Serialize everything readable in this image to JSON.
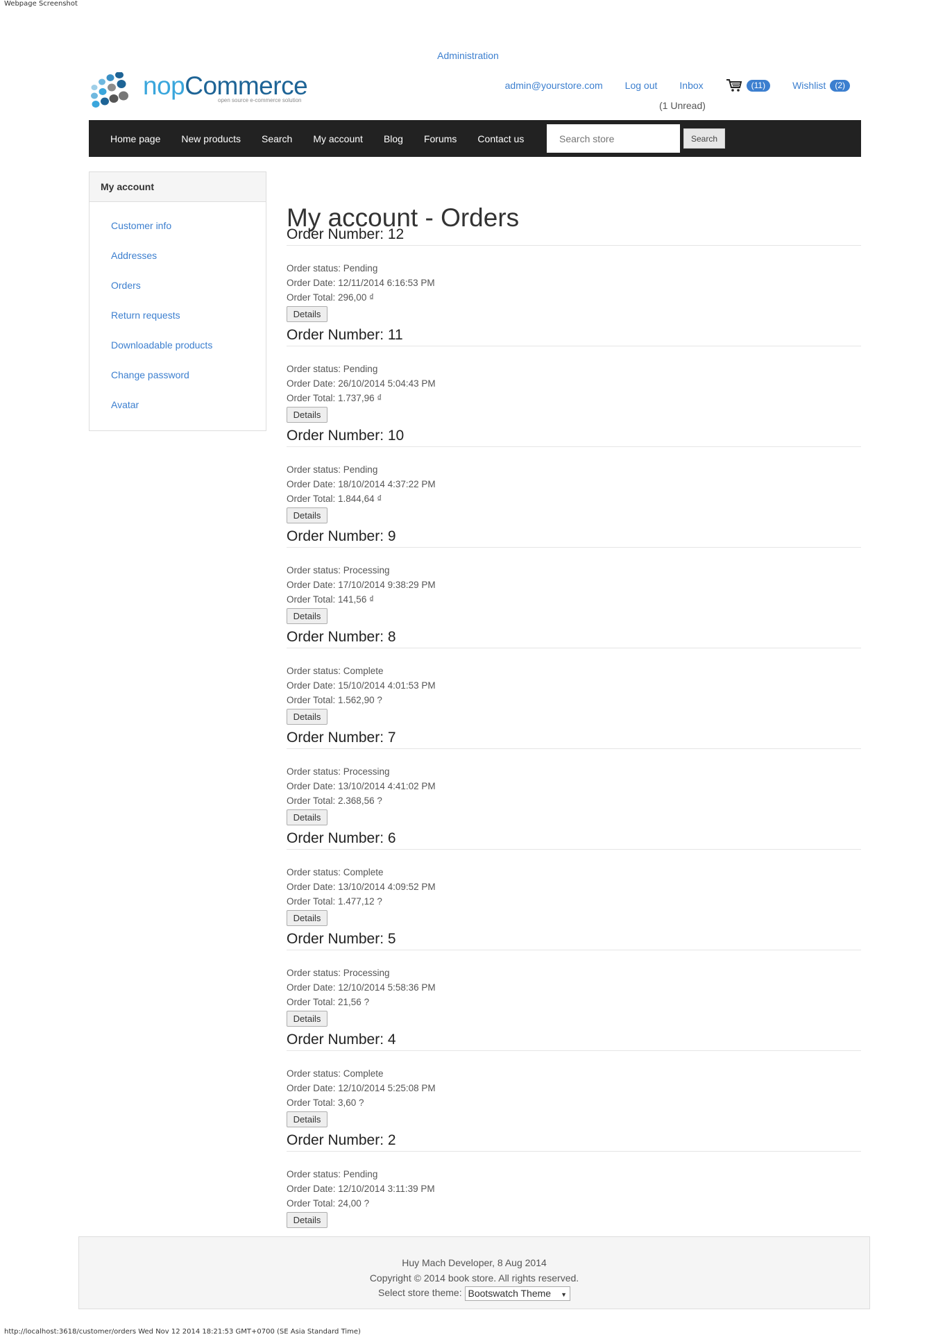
{
  "screenshot_label": "Webpage Screenshot",
  "header": {
    "admin_link": "Administration",
    "logo_text_a": "nop",
    "logo_text_b": "Commerce",
    "logo_tagline": "open source e-commerce solution",
    "account_email": "admin@yourstore.com",
    "logout": "Log out",
    "inbox": "Inbox",
    "inbox_unread": "(1 Unread)",
    "cart_count": "(11)",
    "wishlist": "Wishlist",
    "wishlist_count": "(2)",
    "brand_color": "#1e6496",
    "accent_color": "#3c7fcf"
  },
  "nav": {
    "items": [
      "Home page",
      "New products",
      "Search",
      "My account",
      "Blog",
      "Forums",
      "Contact us"
    ],
    "search_placeholder": "Search store",
    "search_button": "Search"
  },
  "sidebar": {
    "title": "My account",
    "items": [
      "Customer info",
      "Addresses",
      "Orders",
      "Return requests",
      "Downloadable products",
      "Change password",
      "Avatar"
    ]
  },
  "main": {
    "title": "My account - Orders",
    "details_label": "Details",
    "orders": [
      {
        "title": "Order Number: 12",
        "status": "Order status: Pending",
        "date": "Order Date: 12/11/2014 6:16:53 PM",
        "total": "Order Total: 296,00 ₫"
      },
      {
        "title": "Order Number: 11",
        "status": "Order status: Pending",
        "date": "Order Date: 26/10/2014 5:04:43 PM",
        "total": "Order Total: 1.737,96 ₫"
      },
      {
        "title": "Order Number: 10",
        "status": "Order status: Pending",
        "date": "Order Date: 18/10/2014 4:37:22 PM",
        "total": "Order Total: 1.844,64 ₫"
      },
      {
        "title": "Order Number: 9",
        "status": "Order status: Processing",
        "date": "Order Date: 17/10/2014 9:38:29 PM",
        "total": "Order Total: 141,56 ₫"
      },
      {
        "title": "Order Number: 8",
        "status": "Order status: Complete",
        "date": "Order Date: 15/10/2014 4:01:53 PM",
        "total": "Order Total: 1.562,90 ?"
      },
      {
        "title": "Order Number: 7",
        "status": "Order status: Processing",
        "date": "Order Date: 13/10/2014 4:41:02 PM",
        "total": "Order Total: 2.368,56 ?"
      },
      {
        "title": "Order Number: 6",
        "status": "Order status: Complete",
        "date": "Order Date: 13/10/2014 4:09:52 PM",
        "total": "Order Total: 1.477,12 ?"
      },
      {
        "title": "Order Number: 5",
        "status": "Order status: Processing",
        "date": "Order Date: 12/10/2014 5:58:36 PM",
        "total": "Order Total: 21,56 ?"
      },
      {
        "title": "Order Number: 4",
        "status": "Order status: Complete",
        "date": "Order Date: 12/10/2014 5:25:08 PM",
        "total": "Order Total: 3,60 ?"
      },
      {
        "title": "Order Number: 2",
        "status": "Order status: Pending",
        "date": "Order Date: 12/10/2014 3:11:39 PM",
        "total": "Order Total: 24,00 ?"
      }
    ]
  },
  "footer": {
    "line1": "Huy Mach Developer, 8 Aug 2014",
    "line2": "Copyright © 2014 book store. All rights reserved.",
    "theme_label": "Select store theme:",
    "theme_value": "Bootswatch Theme"
  },
  "status_bar": "http://localhost:3618/customer/orders Wed Nov 12 2014 18:21:53 GMT+0700 (SE Asia Standard Time)"
}
